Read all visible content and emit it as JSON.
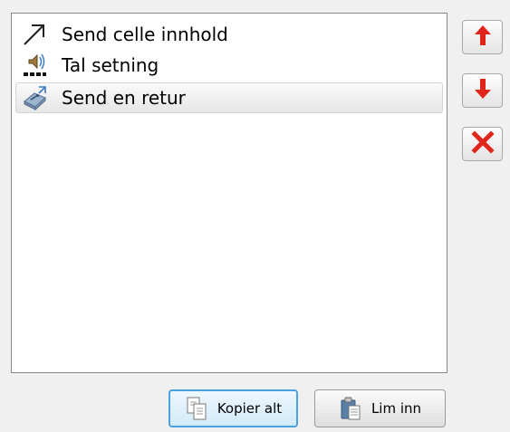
{
  "list": {
    "items": [
      {
        "label": "Send celle innhold",
        "icon": "arrow-diagonal-icon"
      },
      {
        "label": "Tal setning",
        "icon": "speaker-icon"
      },
      {
        "label": "Send en retur",
        "icon": "enter-key-icon"
      }
    ],
    "selected_index": 2
  },
  "side_buttons": {
    "move_up_icon": "arrow-up-icon",
    "move_down_icon": "arrow-down-icon",
    "delete_icon": "delete-x-icon"
  },
  "bottom_buttons": {
    "copy_all_label": "Kopier alt",
    "paste_label": "Lim inn"
  },
  "colors": {
    "accent_red": "#e0251b",
    "focus_blue": "#4aa3e0",
    "selection_bg": "#ebebeb"
  }
}
